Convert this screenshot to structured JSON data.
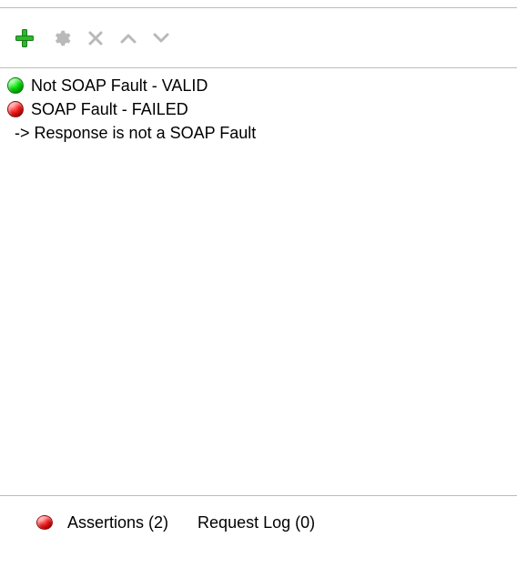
{
  "assertions": {
    "items": [
      {
        "text": "Not SOAP Fault - VALID",
        "status": "green"
      },
      {
        "text": "SOAP Fault - FAILED",
        "status": "red"
      }
    ],
    "messages": [
      "-> Response is not a SOAP Fault"
    ]
  },
  "tabs": {
    "assertions_label": "Assertions (2)",
    "request_log_label": "Request Log (0)"
  },
  "counts": {
    "assertions": 2,
    "request_log": 0
  }
}
